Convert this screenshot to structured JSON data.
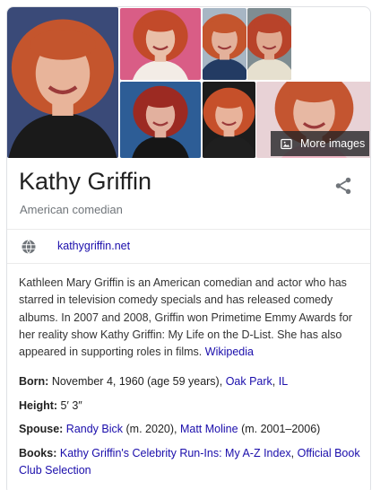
{
  "gallery": {
    "more_images_label": "More images",
    "photos": [
      {
        "subject": "smiling redhead with pearl necklace",
        "bg": "#3a4a78",
        "hair": "#c4552d",
        "skin": "#e8b49a",
        "cloth": "#1a1a1a"
      },
      {
        "subject": "flexing arm on pink backdrop",
        "bg": "#d95d86",
        "hair": "#c24a2a",
        "skin": "#e9bfa8",
        "cloth": "#f3ece6"
      },
      {
        "subject": "portrait in navy top",
        "bg": "#a7b6c4",
        "hair": "#c4552d",
        "skin": "#e3b19b",
        "cloth": "#233b63"
      },
      {
        "subject": "closeup with curly hair",
        "bg": "#7f8d92",
        "hair": "#b8432a",
        "skin": "#e0a990",
        "cloth": "#e6e0cf"
      },
      {
        "subject": "red carpet photo",
        "bg": "#2d5d96",
        "hair": "#9c2a22",
        "skin": "#e2b09e",
        "cloth": "#161616"
      },
      {
        "subject": "smiling portrait",
        "bg": "#1c1c1c",
        "hair": "#c6502a",
        "skin": "#e8b39b",
        "cloth": "#1f1f1f"
      },
      {
        "subject": "interview on stage",
        "bg": "#e8d2d6",
        "hair": "#c45530",
        "skin": "#e7b8a3",
        "cloth": "#f0b6c4"
      }
    ]
  },
  "header": {
    "title": "Kathy Griffin",
    "subtitle": "American comedian"
  },
  "website": {
    "label": "kathygriffin.net"
  },
  "description": {
    "text": "Kathleen Mary Griffin is an American comedian and actor who has starred in television comedy specials and has released comedy albums. In 2007 and 2008, Griffin won Primetime Emmy Awards for her reality show Kathy Griffin: My Life on the D-List. She has also appeared in supporting roles in films.",
    "source": "Wikipedia"
  },
  "facts": {
    "born": {
      "label": "Born:",
      "value": "November 4, 1960 (age 59 years),",
      "place_city": "Oak Park",
      "place_sep": ",",
      "place_state": "IL"
    },
    "height": {
      "label": "Height:",
      "value": "5′ 3″"
    },
    "spouse": {
      "label": "Spouse:",
      "spouse1": "Randy Bick",
      "spouse1_note": "(m. 2020),",
      "spouse2": "Matt Moline",
      "spouse2_note": "(m. 2001–2006)"
    },
    "books": {
      "label": "Books:",
      "book1": "Kathy Griffin's Celebrity Run-Ins: My A-Z Index",
      "sep": ",",
      "book2": "Official Book Club Selection"
    }
  },
  "colors": {
    "link": "#1a0dab",
    "muted": "#70757a",
    "divider": "#ebebeb",
    "overlay": "rgba(32,33,36,0.78)"
  },
  "icons": [
    "image-icon",
    "share-icon",
    "globe-icon"
  ]
}
